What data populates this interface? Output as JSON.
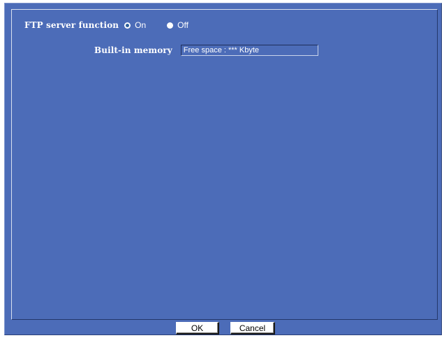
{
  "ftp": {
    "label": "FTP server function",
    "options": [
      {
        "label": "On",
        "selected": true
      },
      {
        "label": "Off",
        "selected": false
      }
    ]
  },
  "memory": {
    "label": "Built-in memory",
    "value": "Free space : *** Kbyte"
  },
  "buttons": {
    "ok_label": "OK",
    "cancel_label": "Cancel"
  },
  "colors": {
    "background": "#4c6cb8",
    "text": "#ffffff"
  }
}
